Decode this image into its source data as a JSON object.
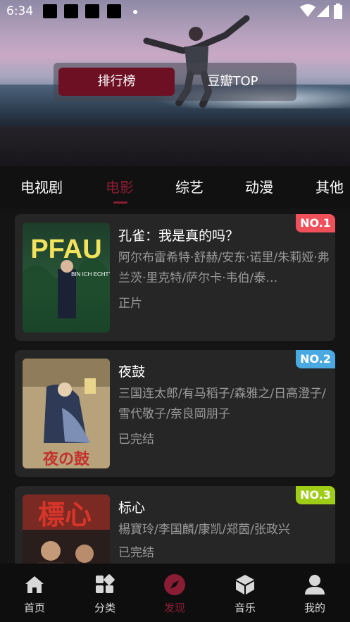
{
  "status": {
    "time": "6:34"
  },
  "toggle": {
    "ranking": "排行榜",
    "douban": "豆瓣TOP"
  },
  "tabs": [
    "电视剧",
    "电影",
    "综艺",
    "动漫",
    "其他"
  ],
  "items": [
    {
      "rank": "NO.1",
      "badge_color": "#f0505a",
      "title": "孔雀：我是真的吗？",
      "cast": "阿尔布雷希特·舒赫/安东·诺里/朱莉娅·弗兰茨·里克特/萨尔卡·韦伯/泰…",
      "status": "正片",
      "poster_title": "PFAU",
      "poster_sub": "BIN ICH ECHT?"
    },
    {
      "rank": "NO.2",
      "badge_color": "#4aa9e0",
      "title": "夜鼓",
      "cast": "三国连太郎/有马稻子/森雅之/日高澄子/雪代敬子/奈良岡朋子",
      "status": "已完结",
      "poster_title": "夜の鼓"
    },
    {
      "rank": "NO.3",
      "badge_color": "#9fcc17",
      "title": "标心",
      "cast": "楊寶玲/李国麟/康凯/郑茵/张政兴",
      "status": "已完结",
      "poster_title": "標心"
    }
  ],
  "bottom_nav": [
    "首页",
    "分类",
    "发现",
    "音乐",
    "我的"
  ],
  "colors": {
    "accent": "#8a1c34",
    "background": "#141414",
    "card": "#262626"
  }
}
